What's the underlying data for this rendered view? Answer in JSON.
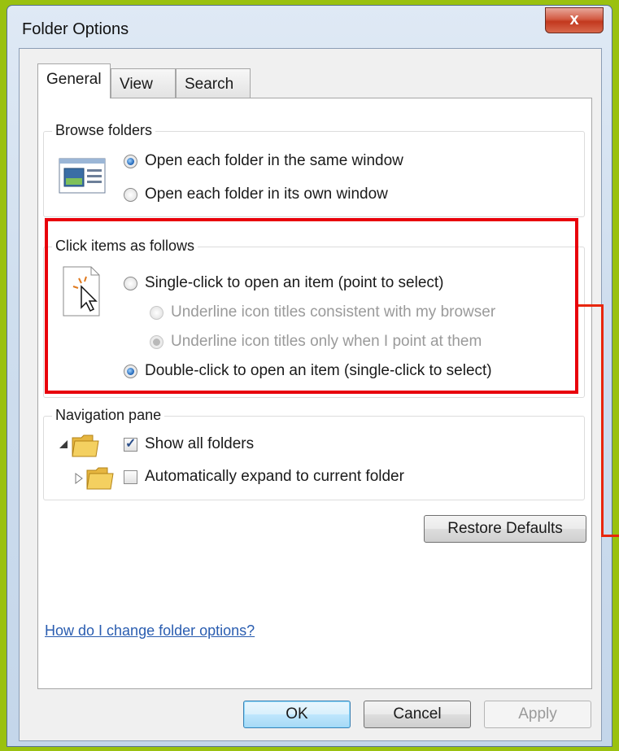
{
  "window": {
    "title": "Folder Options",
    "close_glyph": "x"
  },
  "tabs": [
    {
      "label": "General",
      "active": true
    },
    {
      "label": "View",
      "active": false
    },
    {
      "label": "Search",
      "active": false
    }
  ],
  "browse": {
    "legend": "Browse folders",
    "option_same": "Open each folder in the same window",
    "option_own": "Open each folder in its own window",
    "selected": "same",
    "icon": "folder-window-icon"
  },
  "click": {
    "legend": "Click items as follows",
    "single": "Single-click to open an item (point to select)",
    "underline_browser": "Underline icon titles consistent with my browser",
    "underline_point": "Underline icon titles only when I point at them",
    "double": "Double-click to open an item (single-click to select)",
    "selected": "double",
    "icon": "click-document-icon"
  },
  "nav": {
    "legend": "Navigation pane",
    "show_all": "Show all folders",
    "show_all_checked": true,
    "auto_expand": "Automatically expand to current folder",
    "auto_expand_checked": false
  },
  "buttons": {
    "restore": "Restore Defaults",
    "ok": "OK",
    "cancel": "Cancel",
    "apply": "Apply"
  },
  "help_link": "How do I change folder options?",
  "colors": {
    "highlight": "#e8000b",
    "background": "#9ac10f",
    "link": "#2a5db0"
  }
}
